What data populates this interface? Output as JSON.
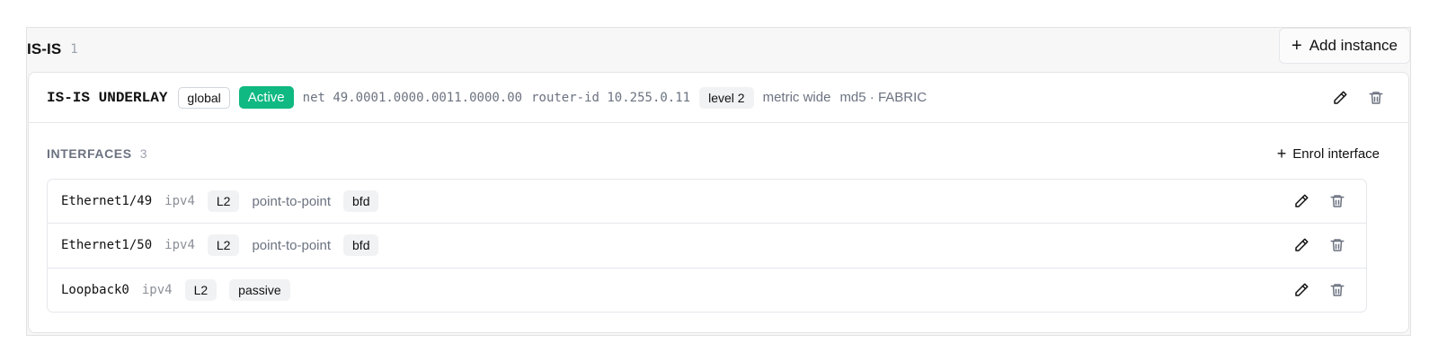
{
  "section": {
    "title": "IS-IS",
    "count": "1",
    "add_label": "Add instance"
  },
  "instance": {
    "name": "IS-IS UNDERLAY",
    "vrf": "global",
    "status": "Active",
    "net": "net 49.0001.0000.0011.0000.00",
    "router_id": "router-id 10.255.0.11",
    "level": "level 2",
    "metric": "metric wide",
    "auth": "md5 · FABRIC"
  },
  "interfaces": {
    "title": "INTERFACES",
    "count": "3",
    "enrol_label": "Enrol interface",
    "rows": [
      {
        "name": "Ethernet1/49",
        "family": "ipv4",
        "level": "L2",
        "network": "point-to-point",
        "flag": "bfd"
      },
      {
        "name": "Ethernet1/50",
        "family": "ipv4",
        "level": "L2",
        "network": "point-to-point",
        "flag": "bfd"
      },
      {
        "name": "Loopback0",
        "family": "ipv4",
        "level": "L2",
        "flag": "passive"
      }
    ]
  },
  "colors": {
    "active_badge": "#10b981",
    "border": "#e5e7eb",
    "muted_text": "#6b7280"
  },
  "icons": {
    "add": "plus-icon",
    "edit": "pencil-icon",
    "delete": "trash-icon"
  }
}
